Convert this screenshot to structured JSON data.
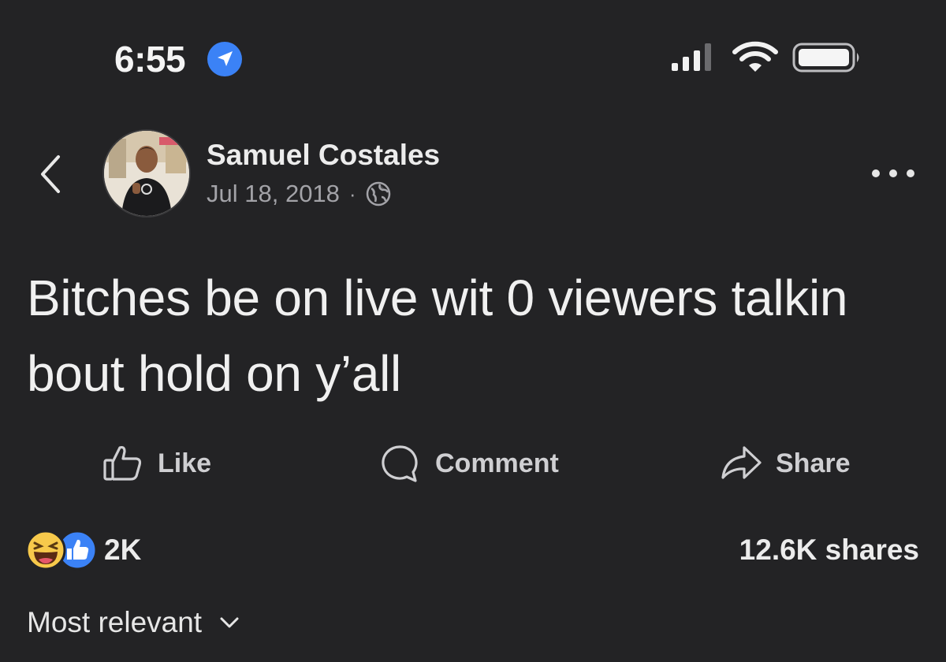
{
  "status_bar": {
    "time": "6:55",
    "icons": [
      "location-arrow-icon",
      "cellular-signal-icon",
      "wifi-icon",
      "battery-icon"
    ]
  },
  "post": {
    "back_icon": "chevron-left-icon",
    "author": "Samuel Costales",
    "date": "Jul 18, 2018",
    "separator": "·",
    "audience_icon": "globe-icon",
    "more_icon": "more-options-icon",
    "text": "Bitches be on live wit 0 viewers talkin bout hold on y’all"
  },
  "actions": {
    "like": {
      "label": "Like",
      "icon": "thumbs-up-icon"
    },
    "comment": {
      "label": "Comment",
      "icon": "speech-bubble-icon"
    },
    "share": {
      "label": "Share",
      "icon": "share-arrow-icon"
    }
  },
  "engagement": {
    "reaction_icons": [
      "haha-icon",
      "like-reaction-icon"
    ],
    "reaction_count": "2K",
    "shares": "12.6K shares"
  },
  "comments": {
    "sort_label": "Most relevant",
    "sort_icon": "chevron-down-icon"
  },
  "colors": {
    "background": "#232325",
    "accent_blue": "#3b82f6",
    "text_primary": "#ececec",
    "text_secondary": "#a3a3a8",
    "haha_yellow": "#f7c94b"
  }
}
